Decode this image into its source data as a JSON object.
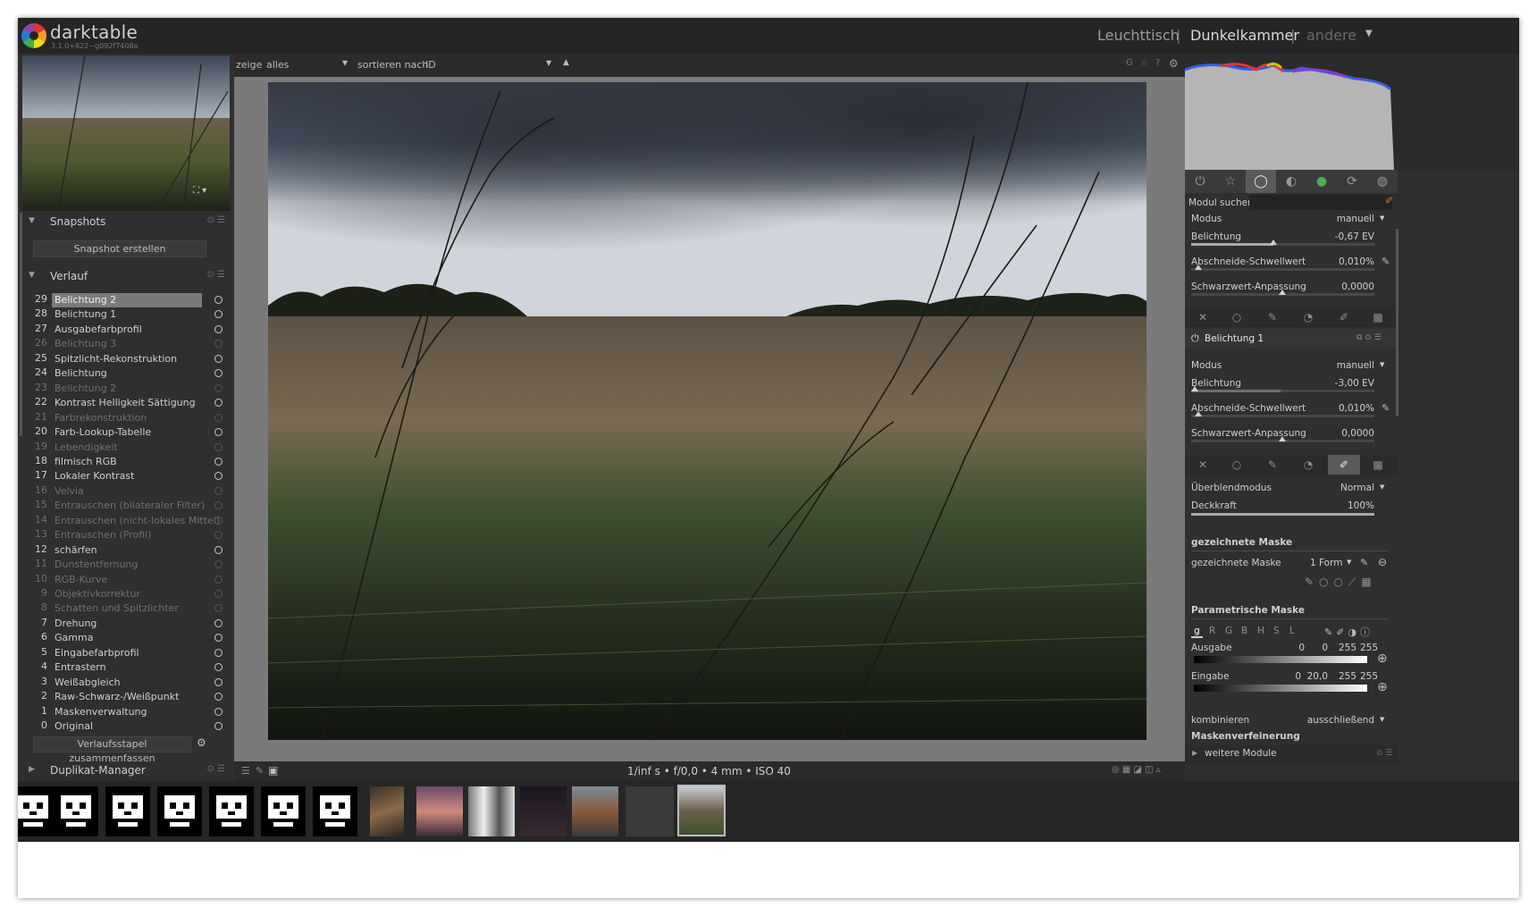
{
  "app": {
    "name": "darktable",
    "version": "3.1.0+822~g092f7408a"
  },
  "views": {
    "lighttable": "Leuchttisch",
    "darkroom": "Dunkelkammer",
    "other": "andere",
    "sep": "|"
  },
  "left": {
    "snapshots": {
      "title": "Snapshots",
      "button": "Snapshot erstellen"
    },
    "history": {
      "title": "Verlauf",
      "items": [
        {
          "n": "29",
          "label": "Belichtung 2",
          "state": "on",
          "selected": true
        },
        {
          "n": "28",
          "label": "Belichtung 1",
          "state": "on"
        },
        {
          "n": "27",
          "label": "Ausgabefarbprofil",
          "state": "on"
        },
        {
          "n": "26",
          "label": "Belichtung 3",
          "state": "off"
        },
        {
          "n": "25",
          "label": "Spitzlicht-Rekonstruktion",
          "state": "on"
        },
        {
          "n": "24",
          "label": "Belichtung",
          "state": "on"
        },
        {
          "n": "23",
          "label": "Belichtung 2",
          "state": "off"
        },
        {
          "n": "22",
          "label": "Kontrast Helligkeit Sättigung",
          "state": "on"
        },
        {
          "n": "21",
          "label": "Farbrekonstruktion",
          "state": "off"
        },
        {
          "n": "20",
          "label": "Farb-Lookup-Tabelle",
          "state": "on"
        },
        {
          "n": "19",
          "label": "Lebendigkeit",
          "state": "off"
        },
        {
          "n": "18",
          "label": "filmisch RGB",
          "state": "on"
        },
        {
          "n": "17",
          "label": "Lokaler Kontrast",
          "state": "on"
        },
        {
          "n": "16",
          "label": "Velvia",
          "state": "off"
        },
        {
          "n": "15",
          "label": "Entrauschen (bilateraler Filter)",
          "state": "off"
        },
        {
          "n": "14",
          "label": "Entrauschen (nicht-lokales Mittel)",
          "state": "off"
        },
        {
          "n": "13",
          "label": "Entrauschen (Profil)",
          "state": "off"
        },
        {
          "n": "12",
          "label": "schärfen",
          "state": "on"
        },
        {
          "n": "11",
          "label": "Dunstentfernung",
          "state": "off"
        },
        {
          "n": "10",
          "label": "RGB-Kurve",
          "state": "off"
        },
        {
          "n": "9",
          "label": "Objektivkorrektur",
          "state": "off"
        },
        {
          "n": "8",
          "label": "Schatten und Spitzlichter",
          "state": "off"
        },
        {
          "n": "7",
          "label": "Drehung",
          "state": "on"
        },
        {
          "n": "6",
          "label": "Gamma",
          "state": "on"
        },
        {
          "n": "5",
          "label": "Eingabefarbprofil",
          "state": "on"
        },
        {
          "n": "4",
          "label": "Entrastern",
          "state": "on"
        },
        {
          "n": "3",
          "label": "Weißabgleich",
          "state": "on"
        },
        {
          "n": "2",
          "label": "Raw-Schwarz-/Weißpunkt",
          "state": "on"
        },
        {
          "n": "1",
          "label": "Maskenverwaltung",
          "state": "on"
        },
        {
          "n": "0",
          "label": "Original",
          "state": "on"
        }
      ],
      "compress_button": "Verlaufsstapel zusammenfassen"
    },
    "duplicate": {
      "title": "Duplikat-Manager"
    }
  },
  "center": {
    "show_label": "zeige",
    "show_value": "alles",
    "sort_label": "sortieren nach",
    "sort_value": "ID",
    "image_info": "1/inf s • f/0,0 • 4 mm • ISO 40"
  },
  "right": {
    "search_label": "Modul suchen",
    "exposure2": {
      "mode_label": "Modus",
      "mode_value": "manuell",
      "exposure_label": "Belichtung",
      "exposure_value": "-0,67 EV",
      "exposure_fraction": 0.45,
      "clip_label": "Abschneide-Schwellwert",
      "clip_value": "0,010%",
      "black_label": "Schwarzwert-Anpassung",
      "black_value": "0,0000"
    },
    "exposure1": {
      "title": "Belichtung 1",
      "mode_label": "Modus",
      "mode_value": "manuell",
      "exposure_label": "Belichtung",
      "exposure_value": "-3,00 EV",
      "exposure_fraction": 0.0,
      "clip_label": "Abschneide-Schwellwert",
      "clip_value": "0,010%",
      "black_label": "Schwarzwert-Anpassung",
      "black_value": "0,0000"
    },
    "blend": {
      "blendmode_label": "Überblendmodus",
      "blendmode_value": "Normal",
      "opacity_label": "Deckkraft",
      "opacity_value": "100%",
      "opacity_fraction": 1.0
    },
    "drawn_mask": {
      "section": "gezeichnete Maske",
      "label": "gezeichnete Maske",
      "value": "1 Form"
    },
    "param_mask": {
      "section": "Parametrische Maske",
      "channels": [
        "g",
        "R",
        "G",
        "B",
        "H",
        "S",
        "L"
      ],
      "output_label": "Ausgabe",
      "output_values": [
        "0",
        "0",
        "255",
        "255"
      ],
      "input_label": "Eingabe",
      "input_values": [
        "0",
        "20,0",
        "255",
        "255"
      ],
      "combine_label": "kombinieren",
      "combine_value": "ausschließend",
      "refine_label": "Maskenverfeinerung"
    },
    "more_modules": "weitere Module"
  },
  "colors": {
    "accent_selected": "#7a7a7a",
    "panel": "#2f2f2f",
    "background": "#2b2b2b"
  }
}
